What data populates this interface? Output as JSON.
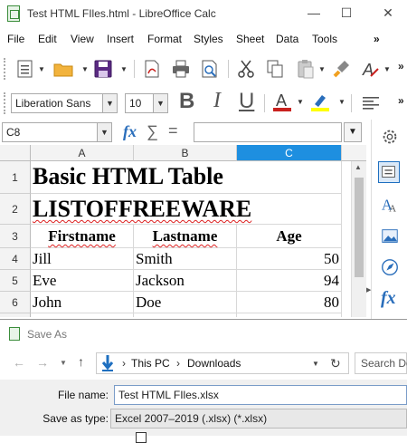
{
  "window": {
    "title": "Test HTML FIles.html - LibreOffice Calc",
    "minimize": "—",
    "maximize": "☐",
    "close": "✕"
  },
  "menubar": {
    "items": [
      "File",
      "Edit",
      "View",
      "Insert",
      "Format",
      "Styles",
      "Sheet",
      "Data",
      "Tools"
    ],
    "overflow": "»"
  },
  "toolbar": {
    "overflow": "»",
    "font_name": "Liberation Sans",
    "font_size": "10",
    "bold": "B",
    "italic": "I",
    "underline": "U",
    "font_color_letter": "A",
    "font_color": "#c9211e",
    "highlight_color": "#ffff00"
  },
  "formula_bar": {
    "name_box": "C8",
    "fx": "fx",
    "sum": "∑",
    "equals": "="
  },
  "sheet": {
    "columns": [
      "A",
      "B",
      "C"
    ],
    "selected_column": "C",
    "rows": [
      "1",
      "2",
      "3",
      "4",
      "5",
      "6"
    ],
    "title": "Basic HTML Table",
    "subtitle": "LISTOFFREEWARE",
    "headers": [
      "Firstname",
      "Lastname",
      "Age"
    ],
    "data": [
      {
        "first": "Jill",
        "last": "Smith",
        "age": "50"
      },
      {
        "first": "Eve",
        "last": "Jackson",
        "age": "94"
      },
      {
        "first": "John",
        "last": "Doe",
        "age": "80"
      }
    ]
  },
  "sidebar": {
    "icons": [
      "gear-icon",
      "properties-icon",
      "styles-icon",
      "gallery-icon",
      "navigator-icon",
      "functions-icon"
    ],
    "functions_label": "fx"
  },
  "save_dialog": {
    "title": "Save As",
    "breadcrumb": [
      "This PC",
      "Downloads"
    ],
    "search_placeholder": "Search Do",
    "file_name_label": "File name:",
    "file_name_value": "Test HTML FIles.xlsx",
    "save_type_label": "Save as type:",
    "save_type_value": "Excel 2007–2019 (.xlsx) (*.xlsx)"
  }
}
